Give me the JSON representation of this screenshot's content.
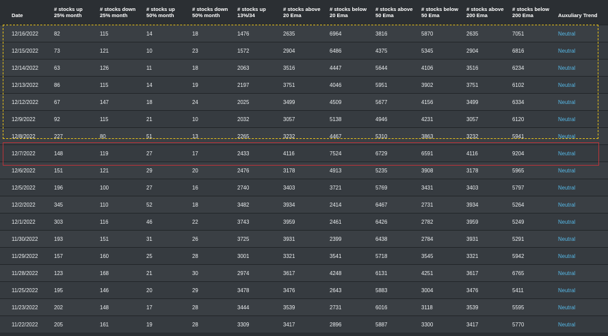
{
  "table": {
    "headers": [
      "Date",
      "# stocks up\n25% month",
      "# stocks down\n25% month",
      "# stocks up\n50% month",
      "# stocks down\n50% month",
      "# stocks up\n13%/34",
      "# stocks above\n20 Ema",
      "# stocks below\n20 Ema",
      "# stocks above\n50 Ema",
      "# stocks below\n50 Ema",
      "# stocks above\n200 Ema",
      "# stocks below\n200 Ema",
      "Auxuliary Trend"
    ],
    "rows": [
      [
        "12/16/2022",
        "82",
        "115",
        "14",
        "18",
        "1476",
        "2635",
        "6964",
        "3816",
        "5870",
        "2635",
        "7051",
        "Neutral"
      ],
      [
        "12/15/2022",
        "73",
        "121",
        "10",
        "23",
        "1572",
        "2904",
        "6486",
        "4375",
        "5345",
        "2904",
        "6816",
        "Neutral"
      ],
      [
        "12/14/2022",
        "63",
        "126",
        "11",
        "18",
        "2063",
        "3516",
        "4447",
        "5644",
        "4106",
        "3516",
        "6234",
        "Neutral"
      ],
      [
        "12/13/2022",
        "86",
        "115",
        "14",
        "19",
        "2197",
        "3751",
        "4046",
        "5951",
        "3902",
        "3751",
        "6102",
        "Neutral"
      ],
      [
        "12/12/2022",
        "67",
        "147",
        "18",
        "24",
        "2025",
        "3499",
        "4509",
        "5677",
        "4156",
        "3499",
        "6334",
        "Neutral"
      ],
      [
        "12/9/2022",
        "92",
        "115",
        "21",
        "10",
        "2032",
        "3057",
        "5138",
        "4946",
        "4231",
        "3057",
        "6120",
        "Neutral"
      ],
      [
        "12/8/2022",
        "227",
        "80",
        "51",
        "13",
        "2265",
        "3232",
        "4467",
        "5310",
        "3863",
        "3232",
        "5941",
        "Neutral"
      ],
      [
        "12/7/2022",
        "148",
        "119",
        "27",
        "17",
        "2433",
        "4116",
        "7524",
        "6729",
        "6591",
        "4116",
        "9204",
        "Neutral"
      ],
      [
        "12/6/2022",
        "151",
        "121",
        "29",
        "20",
        "2476",
        "3178",
        "4913",
        "5235",
        "3908",
        "3178",
        "5965",
        "Neutral"
      ],
      [
        "12/5/2022",
        "196",
        "100",
        "27",
        "16",
        "2740",
        "3403",
        "3721",
        "5769",
        "3431",
        "3403",
        "5797",
        "Neutral"
      ],
      [
        "12/2/2022",
        "345",
        "110",
        "52",
        "18",
        "3482",
        "3934",
        "2414",
        "6467",
        "2731",
        "3934",
        "5264",
        "Neutral"
      ],
      [
        "12/1/2022",
        "303",
        "116",
        "46",
        "22",
        "3743",
        "3959",
        "2461",
        "6426",
        "2782",
        "3959",
        "5249",
        "Neutral"
      ],
      [
        "11/30/2022",
        "193",
        "151",
        "31",
        "26",
        "3725",
        "3931",
        "2399",
        "6438",
        "2784",
        "3931",
        "5291",
        "Neutral"
      ],
      [
        "11/29/2022",
        "157",
        "160",
        "25",
        "28",
        "3001",
        "3321",
        "3541",
        "5718",
        "3545",
        "3321",
        "5942",
        "Neutral"
      ],
      [
        "11/28/2022",
        "123",
        "168",
        "21",
        "30",
        "2974",
        "3617",
        "4248",
        "6131",
        "4251",
        "3617",
        "6765",
        "Neutral"
      ],
      [
        "11/25/2022",
        "195",
        "146",
        "20",
        "29",
        "3478",
        "3476",
        "2643",
        "5883",
        "3004",
        "3476",
        "5411",
        "Neutral"
      ],
      [
        "11/23/2022",
        "202",
        "148",
        "17",
        "28",
        "3444",
        "3539",
        "2731",
        "6016",
        "3118",
        "3539",
        "5595",
        "Neutral"
      ],
      [
        "11/22/2022",
        "205",
        "161",
        "19",
        "28",
        "3309",
        "3417",
        "2896",
        "5887",
        "3300",
        "3417",
        "5770",
        "Neutral"
      ]
    ]
  },
  "colors": {
    "background": "#2b2f33",
    "row": "#3a3f44",
    "trend_text": "#56b8e6",
    "yellow_highlight": "#e8c21a",
    "red_highlight": "#b8343a"
  }
}
